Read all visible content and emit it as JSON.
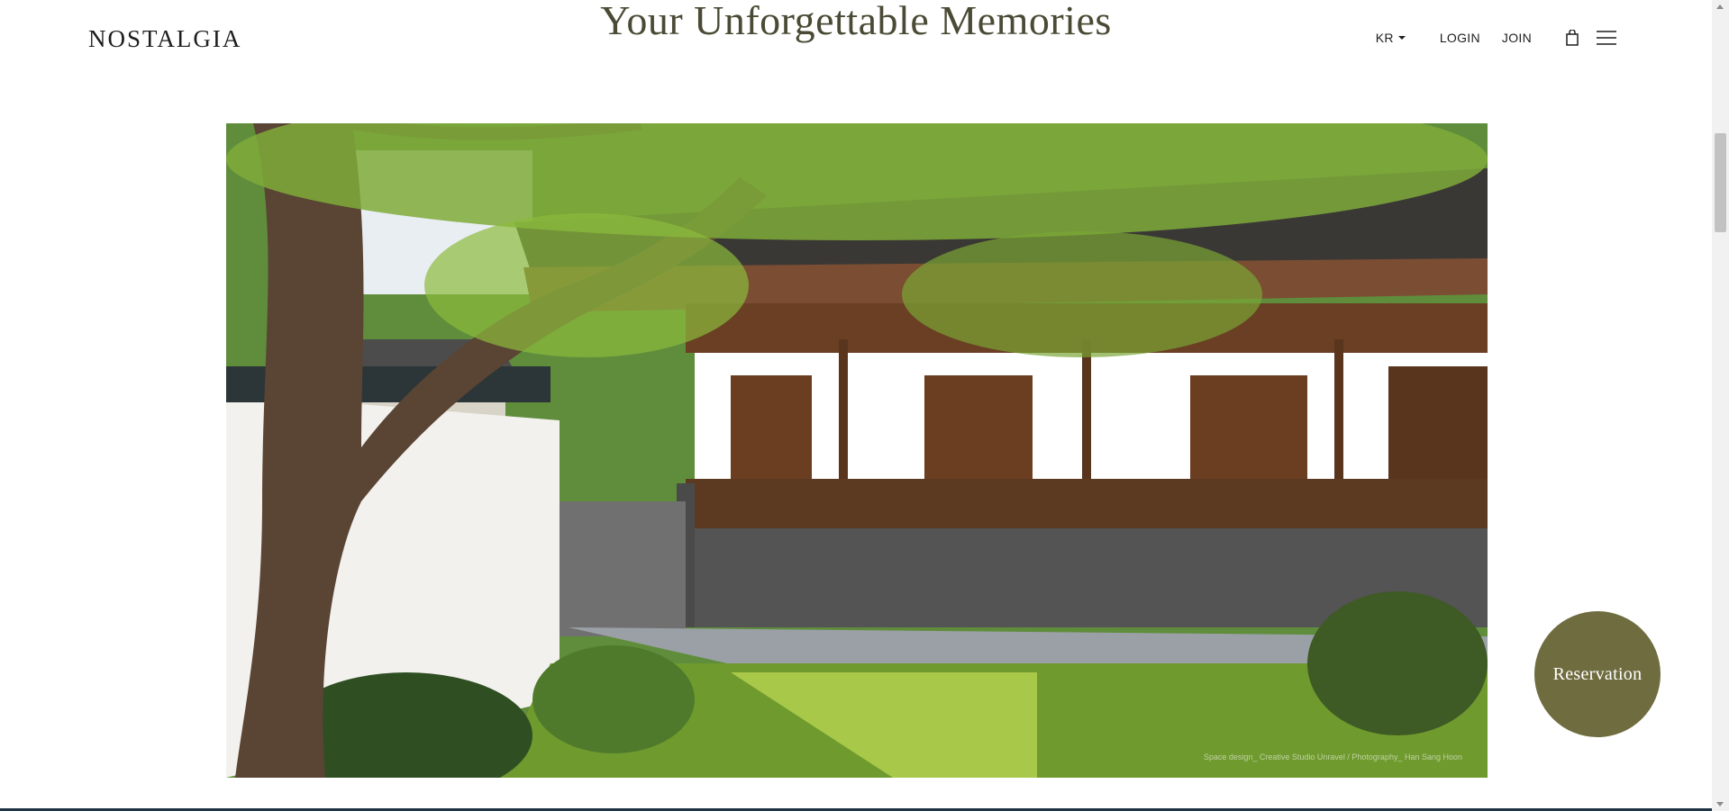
{
  "header": {
    "logo": "NOSTALGIA",
    "title": "Your Unforgettable Memories",
    "nav": {
      "language": "KR",
      "login": "LOGIN",
      "join": "JOIN"
    },
    "icons": {
      "bag": "shopping-bag-icon",
      "menu": "hamburger-menu-icon"
    }
  },
  "hero": {
    "credit": "Space design_ Creative Studio Unravel / Photography_ Han Sang Hoon"
  },
  "reservation": {
    "label": "Reservation"
  },
  "colors": {
    "title": "#4a4a35",
    "reservation": "#6f6c3f",
    "text": "#1d1d1d"
  }
}
